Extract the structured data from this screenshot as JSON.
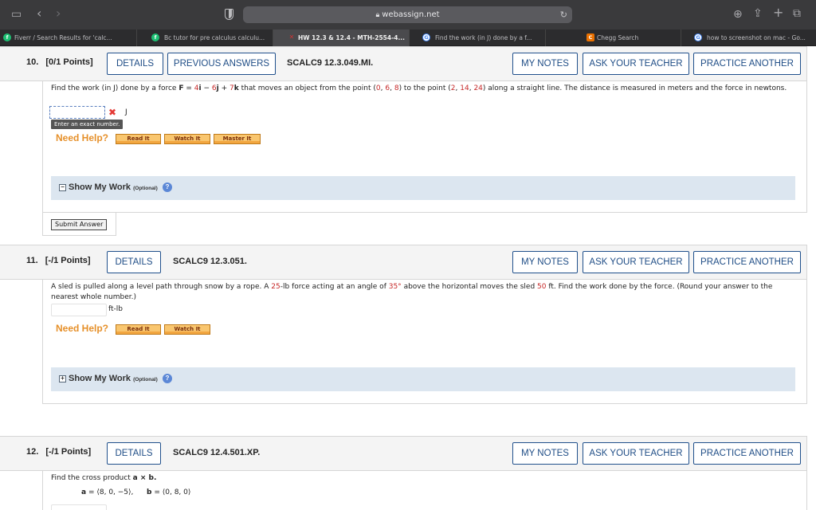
{
  "browser": {
    "url": "webassign.net",
    "tabs": [
      {
        "label": "Fiverr / Search Results for 'calc...",
        "favicon": "fiverr-icon"
      },
      {
        "label": "Bc tutor for pre calculus calculu...",
        "favicon": "fiverr-icon"
      },
      {
        "label": "HW 12.3 & 12.4 - MTH-2554-4...",
        "favicon": "webassign-icon",
        "active": true
      },
      {
        "label": "Find the work (in J) done by a f...",
        "favicon": "google-icon"
      },
      {
        "label": "Chegg Search",
        "favicon": "chegg-icon"
      },
      {
        "label": "how to screenshot on mac - Go...",
        "favicon": "google-icon"
      }
    ]
  },
  "buttons": {
    "details": "DETAILS",
    "previous_answers": "PREVIOUS ANSWERS",
    "my_notes": "MY NOTES",
    "ask_teacher": "ASK YOUR TEACHER",
    "practice_another": "PRACTICE ANOTHER",
    "read_it": "Read It",
    "watch_it": "Watch It",
    "master_it": "Master It",
    "submit_answer": "Submit Answer"
  },
  "need_help": "Need Help?",
  "show_my_work": "Show My Work",
  "optional": "(Optional)",
  "q10": {
    "number": "10.",
    "points": "[0/1 Points]",
    "code": "SCALC9 12.3.049.MI.",
    "text_1": "Find the work (in J) done by a force",
    "F": "F",
    "eq": "=",
    "c1": "4",
    "i": "i",
    "minus": "−",
    "c2": "6",
    "j": "j",
    "plus": "+",
    "c3": "7",
    "k": "k",
    "text_2": "that moves an object from the point (",
    "p1": [
      "0",
      "6",
      "8"
    ],
    "text_3": ") to the point (",
    "p2": [
      "2",
      "14",
      "24"
    ],
    "text_4": ") along a straight line. The distance is measured in meters and the force in newtons.",
    "unit": "J",
    "hint": "Enter an exact number."
  },
  "q11": {
    "number": "11.",
    "points": "[-/1 Points]",
    "code": "SCALC9 12.3.051.",
    "text_1": "A sled is pulled along a level path through snow by a rope. A",
    "force": "25",
    "text_2": "-lb force acting at an angle of",
    "angle": "35°",
    "text_3": "above the horizontal moves the sled",
    "dist": "50",
    "text_4": "ft. Find the work done by the force. (Round your answer to the nearest whole number.)",
    "unit": "ft-lb"
  },
  "q12": {
    "number": "12.",
    "points": "[-/1 Points]",
    "code": "SCALC9 12.4.501.XP.",
    "text_1": "Find the cross product",
    "expr": "a × b.",
    "a_label": "a",
    "a_val": "= ⟨8, 0, −5⟩,",
    "b_label": "b",
    "b_val": "= ⟨0, 8, 0⟩"
  }
}
